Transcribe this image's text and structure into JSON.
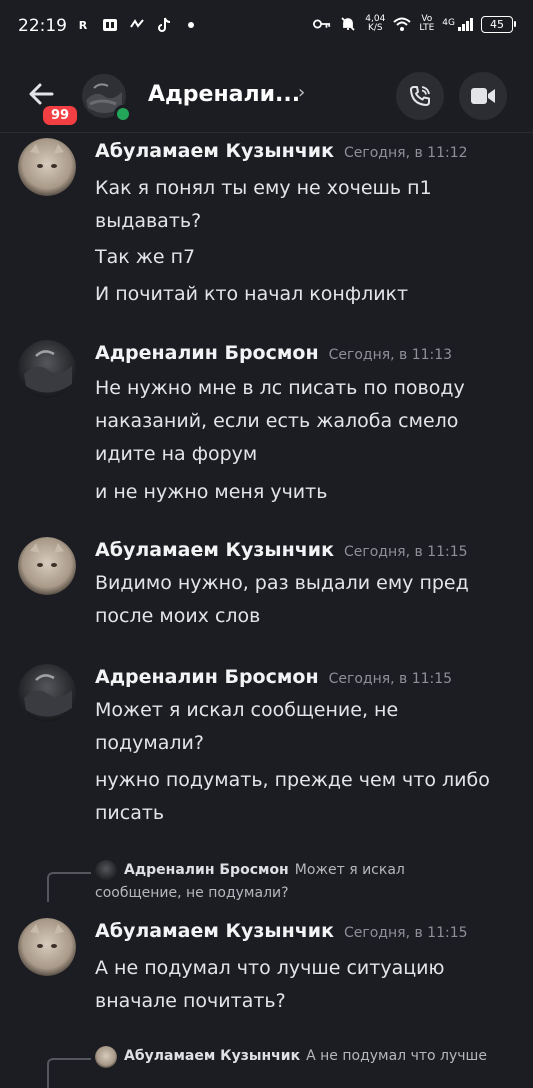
{
  "status_bar": {
    "time": "22:19",
    "left_icons": [
      "r-icon",
      "gallery-icon",
      "activity-icon",
      "tiktok-icon",
      "dot-icon"
    ],
    "speed_top": "4,04",
    "speed_bottom": "K/S",
    "volte_top": "Vo",
    "volte_bottom": "LTE",
    "network": "4G",
    "battery": "45"
  },
  "header": {
    "title": "Адренали...",
    "unread_badge": "99",
    "online": true
  },
  "messages": [
    {
      "author": "Абуламаем Кузынчик",
      "time": "Сегодня, в 11:12",
      "avatar": "cat",
      "lines": [
        "Как я понял ты ему не хочешь п1",
        "выдавать?",
        "Так же п7",
        "И почитай кто начал конфликт"
      ]
    },
    {
      "author": "Адреналин Бросмон",
      "time": "Сегодня, в 11:13",
      "avatar": "dark",
      "lines": [
        "Не нужно мне в лс писать по поводу",
        "наказаний, если есть жалоба смело",
        "идите на форум",
        "и не нужно меня учить"
      ]
    },
    {
      "author": "Абуламаем Кузынчик",
      "time": "Сегодня, в 11:15",
      "avatar": "cat",
      "lines": [
        "Видимо нужно, раз выдали ему пред",
        "после моих слов"
      ]
    },
    {
      "author": "Адреналин Бросмон",
      "time": "Сегодня, в 11:15",
      "avatar": "dark",
      "lines": [
        "Может я искал сообщение, не",
        "подумали?",
        "нужно подумать, прежде чем что либо",
        "писать"
      ]
    },
    {
      "reply": {
        "author": "Адреналин Бросмон",
        "text_line1": "Может я искал",
        "text_line2": "сообщение, не подумали?"
      },
      "author": "Абуламаем Кузынчик",
      "time": "Сегодня, в 11:15",
      "avatar": "cat",
      "lines": [
        "А не подумал что лучше ситуацию",
        "вначале почитать?"
      ]
    }
  ],
  "trailing_reply": {
    "author": "Абуламаем Кузынчик",
    "text": "А не подумал что лучше"
  }
}
